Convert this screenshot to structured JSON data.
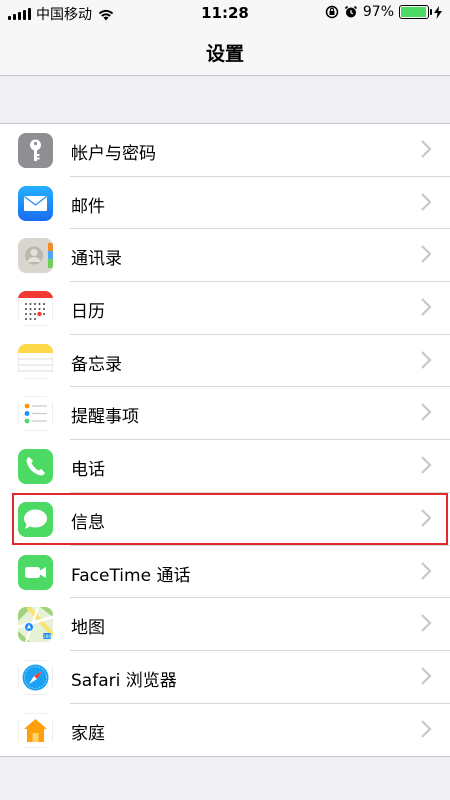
{
  "status_bar": {
    "carrier": "中国移动",
    "time": "11:28",
    "battery": "97%",
    "battery_level": 0.97
  },
  "nav": {
    "title": "设置"
  },
  "settings_items": [
    {
      "label": "帐户与密码",
      "icon": "key-icon"
    },
    {
      "label": "邮件",
      "icon": "mail-icon"
    },
    {
      "label": "通讯录",
      "icon": "contacts-icon"
    },
    {
      "label": "日历",
      "icon": "calendar-icon"
    },
    {
      "label": "备忘录",
      "icon": "notes-icon"
    },
    {
      "label": "提醒事项",
      "icon": "reminders-icon"
    },
    {
      "label": "电话",
      "icon": "phone-icon"
    },
    {
      "label": "信息",
      "icon": "messages-icon",
      "highlighted": true
    },
    {
      "label": "FaceTime 通话",
      "icon": "facetime-icon"
    },
    {
      "label": "地图",
      "icon": "maps-icon"
    },
    {
      "label": "Safari 浏览器",
      "icon": "safari-icon"
    },
    {
      "label": "家庭",
      "icon": "home-icon"
    }
  ],
  "colors": {
    "highlight_border": "#e0282d",
    "messages_green": "#4cd964",
    "mail_blue": "#1a8cff"
  }
}
